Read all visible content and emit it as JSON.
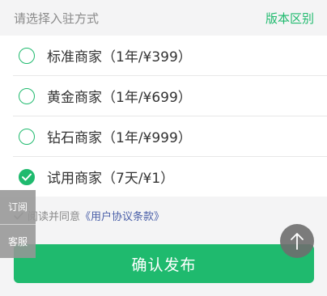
{
  "header": {
    "title": "请选择入驻方式",
    "link": "版本区别"
  },
  "options": [
    {
      "label": "标准商家（1年/¥399）",
      "checked": false
    },
    {
      "label": "黄金商家（1年/¥699）",
      "checked": false
    },
    {
      "label": "钻石商家（1年/¥999）",
      "checked": false
    },
    {
      "label": "试用商家（7天/¥1）",
      "checked": true
    }
  ],
  "agreement": {
    "prefix": "阅读并同意",
    "link": "《用户协议条款》"
  },
  "submit": {
    "label": "确认发布"
  },
  "side_panel": {
    "subscribe": "订阅",
    "service": "客服"
  },
  "icons": {
    "radio": "radio-circle-icon",
    "checkmark": "checkmark-icon",
    "top": "arrow-up-icon"
  },
  "colors": {
    "accent": "#1fba6e",
    "link": "#4a5fa8"
  }
}
